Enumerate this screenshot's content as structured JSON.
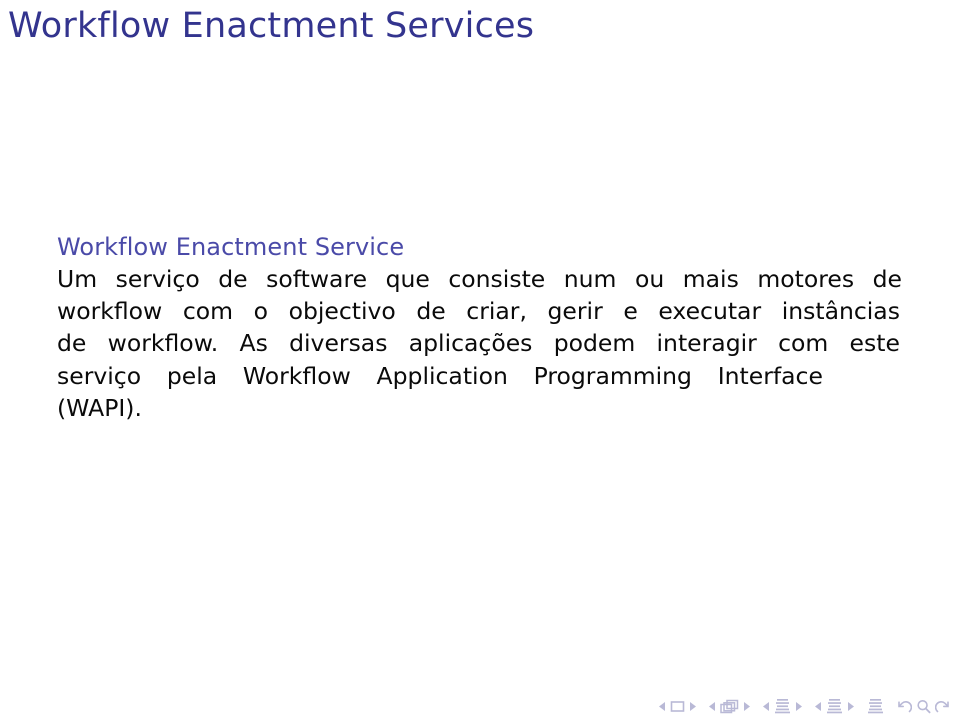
{
  "slide": {
    "frame_title": "Workflow Enactment Services",
    "background_color": "#ffffff",
    "structure_color": "#33348e",
    "block": {
      "title": "Workflow Enactment Service",
      "body_lines": [
        {
          "id": "line1",
          "words": [
            "Um",
            "serviço",
            "de",
            "software",
            "que",
            "consiste",
            "num",
            "ou",
            "mais",
            "motores",
            "de"
          ]
        },
        {
          "id": "line2",
          "words": [
            "workflow",
            "com",
            "o",
            "objectivo",
            "de",
            "criar,",
            "gerir",
            "e",
            "executar",
            "instâncias"
          ]
        },
        {
          "id": "line3",
          "words": [
            "de",
            "workflow.",
            "As",
            "diversas",
            "aplicações",
            "podem",
            "interagir",
            "com",
            "este"
          ]
        },
        {
          "id": "line4",
          "words": [
            "serviço",
            "pela",
            "Workflow",
            "Application",
            "Programming",
            "Interface"
          ]
        },
        {
          "id": "line5",
          "words": [
            "(WAPI)."
          ]
        }
      ],
      "full_text": "Um serviço de software que consiste num ou mais motores de workflow com o objectivo de criar, gerir e executar instâncias de workflow. As diversas aplicações podem interagir com este serviço pela Workflow Application Programming Interface (WAPI)."
    }
  },
  "navigation": {
    "color": "#b9b9d6",
    "groups": [
      {
        "name": "slide",
        "prev_icon": "triangle-left-icon",
        "symbol_icon": "single-slide-icon",
        "next_icon": "triangle-right-icon"
      },
      {
        "name": "frame",
        "prev_icon": "triangle-left-icon",
        "symbol_icon": "stacked-frames-icon",
        "next_icon": "triangle-right-icon"
      },
      {
        "name": "subsection",
        "prev_icon": "triangle-left-icon",
        "symbol_icon": "lines-subsection-icon",
        "next_icon": "triangle-right-icon"
      },
      {
        "name": "section",
        "prev_icon": "triangle-left-icon",
        "symbol_icon": "lines-section-icon",
        "next_icon": "triangle-right-icon"
      }
    ],
    "presentation_icon": "lines-presentation-icon",
    "back_icon": "back-arrow-icon",
    "search_icon": "magnifier-icon",
    "forward_icon": "forward-arrow-icon"
  }
}
